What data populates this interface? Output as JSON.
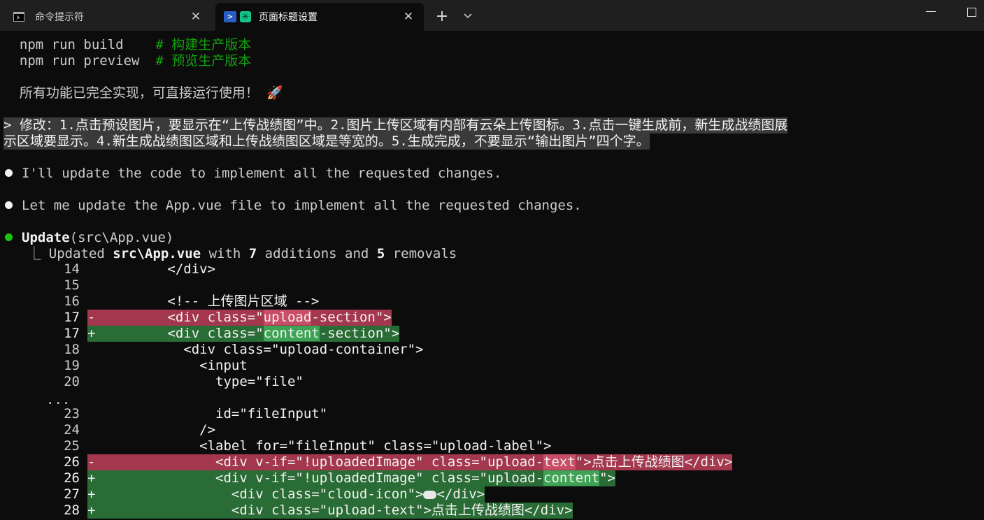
{
  "window": {
    "tabs": [
      {
        "label": "命令提示符",
        "icon": "cmd-icon",
        "active": false
      },
      {
        "label": "页面标题设置",
        "icon": "powershell-icon",
        "active": true
      }
    ],
    "new_tab": "+",
    "dropdown": "⌄",
    "close": "✕"
  },
  "terminal": {
    "build_cmd": "npm run build",
    "build_comment": "# 构建生产版本",
    "preview_cmd": "npm run preview",
    "preview_comment": "# 预览生产版本",
    "done_text": "所有功能已完全实现，可直接运行使用！",
    "done_emoji": "🚀",
    "prompt_line1": "> 修改：1.点击预设图片，要显示在“上传战绩图”中。2.图片上传区域有内部有云朵上传图标。3.点击一键生成前，新生成战绩图展",
    "prompt_line2": "示区域要显示。4.新生成战绩图区域和上传战绩图区域是等宽的。5.生成完成，不要显示“输出图片”四个字。",
    "msg1": "I'll update the code to implement all the requested changes.",
    "msg2": "Let me update the App.vue file to implement all the requested changes.",
    "update_tool": "Update",
    "update_arg": "(src\\App.vue)",
    "result_prefix": "Updated ",
    "result_file": "src\\App.vue",
    "result_with": " with ",
    "result_add": "7",
    "result_mid": " additions and ",
    "result_rem": "5",
    "result_end": " removals",
    "ellipsis": "...",
    "colors": {
      "added": "#2a6c35",
      "removed": "#a3374d",
      "green": "#13a10e"
    }
  },
  "diff": {
    "lines": [
      {
        "num": "14",
        "sign": " ",
        "pre": "      </div>",
        "hl": "",
        "post": ""
      },
      {
        "num": "15",
        "sign": " ",
        "pre": "",
        "hl": "",
        "post": ""
      },
      {
        "num": "16",
        "sign": " ",
        "pre": "      <!-- 上传图片区域 -->",
        "hl": "",
        "post": ""
      },
      {
        "num": "17",
        "sign": "-",
        "pre": "      <div class=\"",
        "hl": "upload",
        "post": "-section\">"
      },
      {
        "num": "17",
        "sign": "+",
        "pre": "      <div class=\"",
        "hl": "content",
        "post": "-section\">"
      },
      {
        "num": "18",
        "sign": " ",
        "pre": "        <div class=\"upload-container\">",
        "hl": "",
        "post": ""
      },
      {
        "num": "19",
        "sign": " ",
        "pre": "          <input",
        "hl": "",
        "post": ""
      },
      {
        "num": "20",
        "sign": " ",
        "pre": "            type=\"file\"",
        "hl": "",
        "post": ""
      },
      {
        "num": "23",
        "sign": " ",
        "pre": "            id=\"fileInput\"",
        "hl": "",
        "post": ""
      },
      {
        "num": "24",
        "sign": " ",
        "pre": "          />",
        "hl": "",
        "post": ""
      },
      {
        "num": "25",
        "sign": " ",
        "pre": "          <label for=\"fileInput\" class=\"upload-label\">",
        "hl": "",
        "post": ""
      },
      {
        "num": "26",
        "sign": "-",
        "pre": "            <div v-if=\"!uploadedImage\" class=\"upload-",
        "hl": "text",
        "post": "\">点击上传战绩图</div>"
      },
      {
        "num": "26",
        "sign": "+",
        "pre": "            <div v-if=\"!uploadedImage\" class=\"upload-",
        "hl": "content",
        "post": "\">"
      },
      {
        "num": "27",
        "sign": "+",
        "pre": "              <div class=\"cloud-icon\">",
        "hl": "",
        "post": "</div>",
        "emoji": "☁️"
      },
      {
        "num": "28",
        "sign": "+",
        "pre": "              <div class=\"upload-text\">点击上传战绩图</div>",
        "hl": "",
        "post": ""
      }
    ]
  }
}
